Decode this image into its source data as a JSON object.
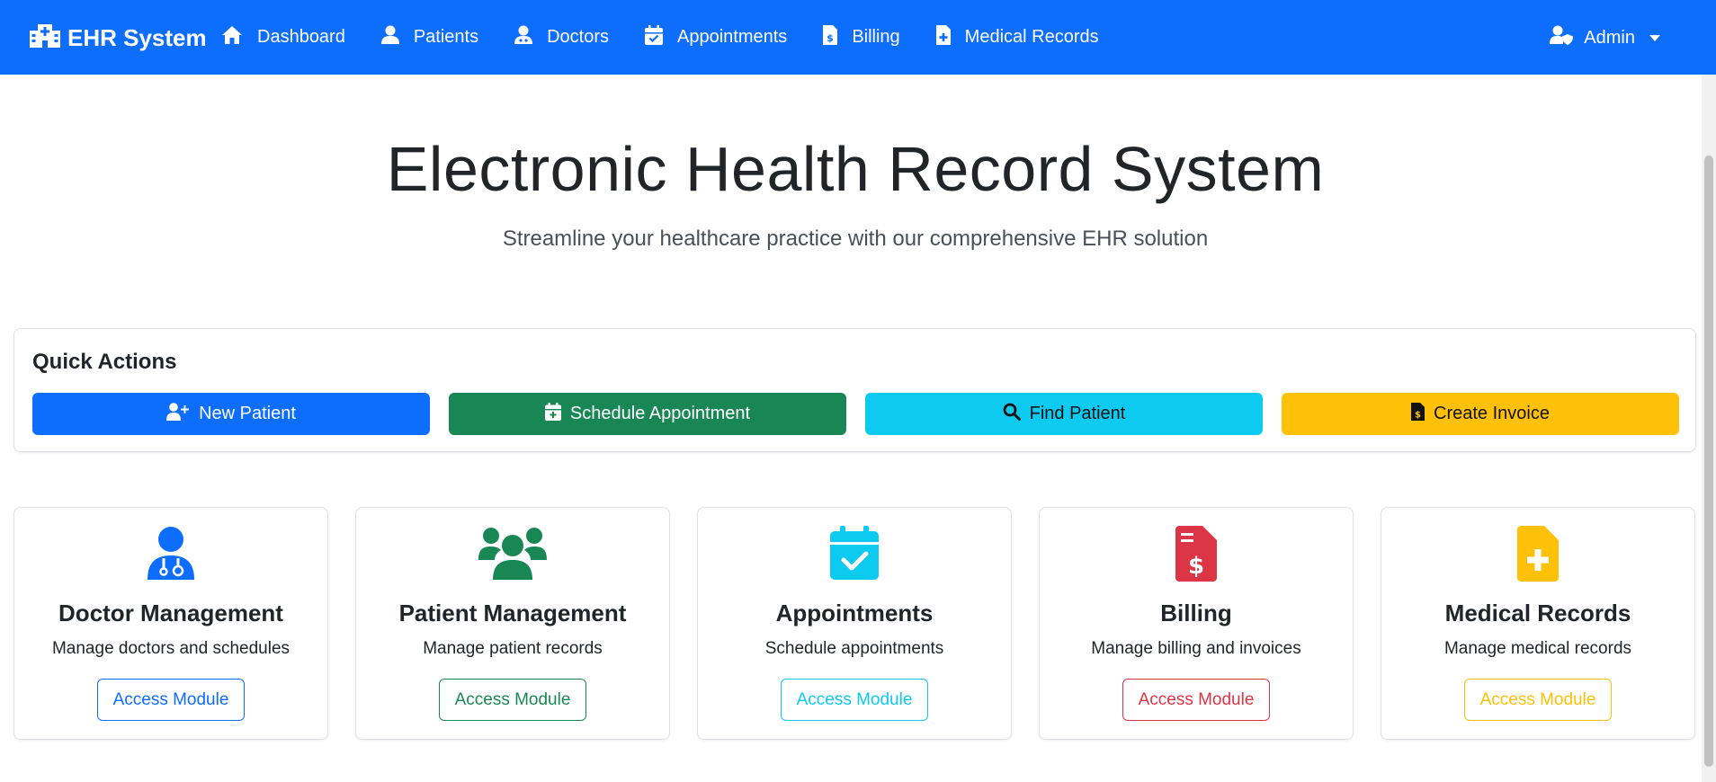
{
  "navbar": {
    "brand": "EHR System",
    "items": [
      {
        "label": "Dashboard",
        "icon": "home-icon"
      },
      {
        "label": "Patients",
        "icon": "user-icon"
      },
      {
        "label": "Doctors",
        "icon": "user-doctor-icon"
      },
      {
        "label": "Appointments",
        "icon": "calendar-check-icon"
      },
      {
        "label": "Billing",
        "icon": "file-invoice-dollar-icon"
      },
      {
        "label": "Medical Records",
        "icon": "file-medical-icon"
      }
    ],
    "admin_label": "Admin"
  },
  "hero": {
    "title": "Electronic Health Record System",
    "subtitle": "Streamline your healthcare practice with our comprehensive EHR solution"
  },
  "quick_actions": {
    "title": "Quick Actions",
    "buttons": [
      {
        "label": "New Patient",
        "icon": "user-plus-icon",
        "color": "#0d6efd"
      },
      {
        "label": "Schedule Appointment",
        "icon": "calendar-plus-icon",
        "color": "#198754"
      },
      {
        "label": "Find Patient",
        "icon": "search-icon",
        "color": "#0dcaf0"
      },
      {
        "label": "Create Invoice",
        "icon": "file-invoice-dollar-icon",
        "color": "#ffc107"
      }
    ]
  },
  "modules": [
    {
      "title": "Doctor Management",
      "desc": "Manage doctors and schedules",
      "button": "Access Module",
      "color": "#0d6efd",
      "icon": "user-doctor-icon"
    },
    {
      "title": "Patient Management",
      "desc": "Manage patient records",
      "button": "Access Module",
      "color": "#198754",
      "icon": "users-icon"
    },
    {
      "title": "Appointments",
      "desc": "Schedule appointments",
      "button": "Access Module",
      "color": "#0dcaf0",
      "icon": "calendar-check-icon"
    },
    {
      "title": "Billing",
      "desc": "Manage billing and invoices",
      "button": "Access Module",
      "color": "#dc3545",
      "icon": "file-invoice-dollar-icon"
    },
    {
      "title": "Medical Records",
      "desc": "Manage medical records",
      "button": "Access Module",
      "color": "#ffc107",
      "icon": "file-medical-icon"
    }
  ],
  "colors": {
    "navbar": "#0d6efd",
    "primary": "#0d6efd",
    "success": "#198754",
    "info": "#0dcaf0",
    "danger": "#dc3545",
    "warning": "#ffc107"
  }
}
